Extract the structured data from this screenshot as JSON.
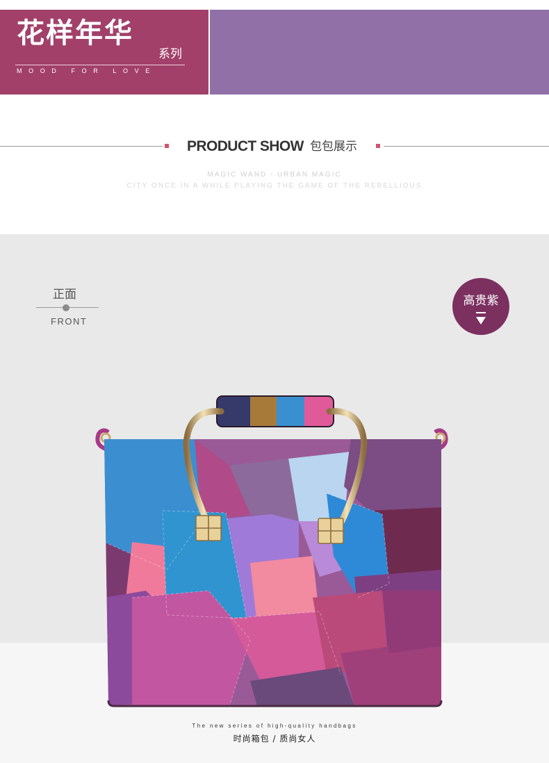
{
  "banner": {
    "title": "花样年华",
    "series": "系列",
    "subtitle": "MOOD FOR LOVE",
    "left_color": "#a2406a",
    "right_color": "#9070a6"
  },
  "product_show": {
    "title": "PRODUCT SHOW",
    "title_cn": "包包展示",
    "tagline_1": "MAGIC WAND - URBAN MAGIC",
    "tagline_2": "CITY ONCE IN A WHILE PLAYING THE GAME OF THE REBELLIOUS"
  },
  "view": {
    "label_cn": "正面",
    "label_en": "FRONT"
  },
  "color_badge": {
    "label": "高贵紫",
    "icon": "down-arrow-icon",
    "color": "#7b3060"
  },
  "footer": {
    "tagline_en": "The new series of high-quality handbags",
    "tagline_cn": "时尚箱包 / 质尚女人"
  }
}
